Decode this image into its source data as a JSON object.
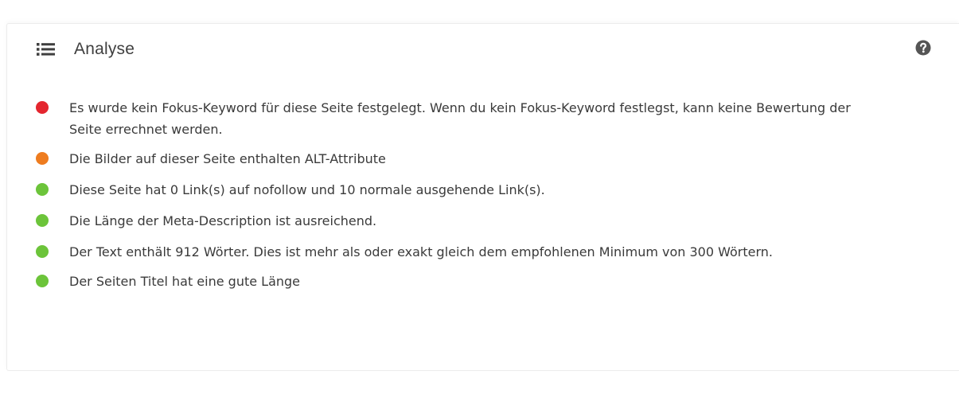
{
  "panel": {
    "title": "Analyse",
    "title_icon": "list-icon",
    "help_icon": "question-circle-icon"
  },
  "items": [
    {
      "status": "error",
      "color": "#e4262f",
      "text": "Es wurde kein Fokus-Keyword für diese Seite festgelegt. Wenn du kein Fokus-Keyword festlegst, kann keine Bewertung der Seite errechnet werden."
    },
    {
      "status": "warning",
      "color": "#ee7c1f",
      "text": "Die Bilder auf dieser Seite enthalten ALT-Attribute"
    },
    {
      "status": "good",
      "color": "#6cc43a",
      "text": "Diese Seite hat 0 Link(s) auf nofollow und 10 normale ausgehende Link(s)."
    },
    {
      "status": "good",
      "color": "#6cc43a",
      "text": "Die Länge der Meta-Description ist ausreichend."
    },
    {
      "status": "good",
      "color": "#6cc43a",
      "text": "Der Text enthält 912 Wörter. Dies ist mehr als oder exakt gleich dem empfohlenen Minimum von 300 Wörtern."
    },
    {
      "status": "good",
      "color": "#6cc43a",
      "text": "Der Seiten Titel hat eine gute Länge"
    }
  ]
}
